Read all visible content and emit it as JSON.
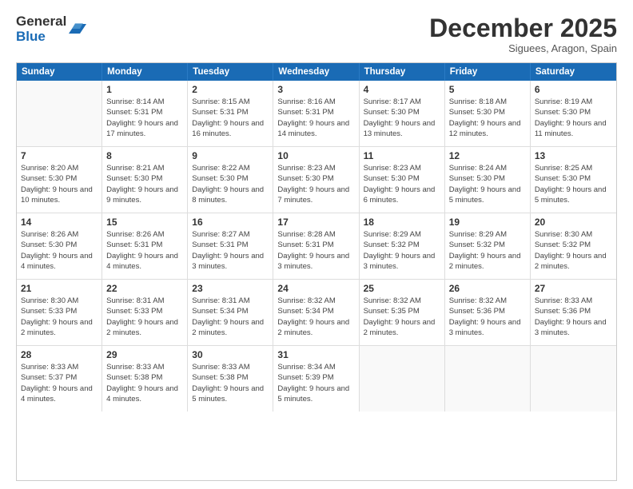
{
  "logo": {
    "general": "General",
    "blue": "Blue"
  },
  "title": "December 2025",
  "location": "Siguees, Aragon, Spain",
  "header_days": [
    "Sunday",
    "Monday",
    "Tuesday",
    "Wednesday",
    "Thursday",
    "Friday",
    "Saturday"
  ],
  "weeks": [
    [
      {
        "day": "",
        "empty": true
      },
      {
        "day": "1",
        "sunrise": "8:14 AM",
        "sunset": "5:31 PM",
        "daylight": "9 hours and 17 minutes."
      },
      {
        "day": "2",
        "sunrise": "8:15 AM",
        "sunset": "5:31 PM",
        "daylight": "9 hours and 16 minutes."
      },
      {
        "day": "3",
        "sunrise": "8:16 AM",
        "sunset": "5:31 PM",
        "daylight": "9 hours and 14 minutes."
      },
      {
        "day": "4",
        "sunrise": "8:17 AM",
        "sunset": "5:30 PM",
        "daylight": "9 hours and 13 minutes."
      },
      {
        "day": "5",
        "sunrise": "8:18 AM",
        "sunset": "5:30 PM",
        "daylight": "9 hours and 12 minutes."
      },
      {
        "day": "6",
        "sunrise": "8:19 AM",
        "sunset": "5:30 PM",
        "daylight": "9 hours and 11 minutes."
      }
    ],
    [
      {
        "day": "7",
        "sunrise": "8:20 AM",
        "sunset": "5:30 PM",
        "daylight": "9 hours and 10 minutes."
      },
      {
        "day": "8",
        "sunrise": "8:21 AM",
        "sunset": "5:30 PM",
        "daylight": "9 hours and 9 minutes."
      },
      {
        "day": "9",
        "sunrise": "8:22 AM",
        "sunset": "5:30 PM",
        "daylight": "9 hours and 8 minutes."
      },
      {
        "day": "10",
        "sunrise": "8:23 AM",
        "sunset": "5:30 PM",
        "daylight": "9 hours and 7 minutes."
      },
      {
        "day": "11",
        "sunrise": "8:23 AM",
        "sunset": "5:30 PM",
        "daylight": "9 hours and 6 minutes."
      },
      {
        "day": "12",
        "sunrise": "8:24 AM",
        "sunset": "5:30 PM",
        "daylight": "9 hours and 5 minutes."
      },
      {
        "day": "13",
        "sunrise": "8:25 AM",
        "sunset": "5:30 PM",
        "daylight": "9 hours and 5 minutes."
      }
    ],
    [
      {
        "day": "14",
        "sunrise": "8:26 AM",
        "sunset": "5:30 PM",
        "daylight": "9 hours and 4 minutes."
      },
      {
        "day": "15",
        "sunrise": "8:26 AM",
        "sunset": "5:31 PM",
        "daylight": "9 hours and 4 minutes."
      },
      {
        "day": "16",
        "sunrise": "8:27 AM",
        "sunset": "5:31 PM",
        "daylight": "9 hours and 3 minutes."
      },
      {
        "day": "17",
        "sunrise": "8:28 AM",
        "sunset": "5:31 PM",
        "daylight": "9 hours and 3 minutes."
      },
      {
        "day": "18",
        "sunrise": "8:29 AM",
        "sunset": "5:32 PM",
        "daylight": "9 hours and 3 minutes."
      },
      {
        "day": "19",
        "sunrise": "8:29 AM",
        "sunset": "5:32 PM",
        "daylight": "9 hours and 2 minutes."
      },
      {
        "day": "20",
        "sunrise": "8:30 AM",
        "sunset": "5:32 PM",
        "daylight": "9 hours and 2 minutes."
      }
    ],
    [
      {
        "day": "21",
        "sunrise": "8:30 AM",
        "sunset": "5:33 PM",
        "daylight": "9 hours and 2 minutes."
      },
      {
        "day": "22",
        "sunrise": "8:31 AM",
        "sunset": "5:33 PM",
        "daylight": "9 hours and 2 minutes."
      },
      {
        "day": "23",
        "sunrise": "8:31 AM",
        "sunset": "5:34 PM",
        "daylight": "9 hours and 2 minutes."
      },
      {
        "day": "24",
        "sunrise": "8:32 AM",
        "sunset": "5:34 PM",
        "daylight": "9 hours and 2 minutes."
      },
      {
        "day": "25",
        "sunrise": "8:32 AM",
        "sunset": "5:35 PM",
        "daylight": "9 hours and 2 minutes."
      },
      {
        "day": "26",
        "sunrise": "8:32 AM",
        "sunset": "5:36 PM",
        "daylight": "9 hours and 3 minutes."
      },
      {
        "day": "27",
        "sunrise": "8:33 AM",
        "sunset": "5:36 PM",
        "daylight": "9 hours and 3 minutes."
      }
    ],
    [
      {
        "day": "28",
        "sunrise": "8:33 AM",
        "sunset": "5:37 PM",
        "daylight": "9 hours and 4 minutes."
      },
      {
        "day": "29",
        "sunrise": "8:33 AM",
        "sunset": "5:38 PM",
        "daylight": "9 hours and 4 minutes."
      },
      {
        "day": "30",
        "sunrise": "8:33 AM",
        "sunset": "5:38 PM",
        "daylight": "9 hours and 5 minutes."
      },
      {
        "day": "31",
        "sunrise": "8:34 AM",
        "sunset": "5:39 PM",
        "daylight": "9 hours and 5 minutes."
      },
      {
        "day": "",
        "empty": true
      },
      {
        "day": "",
        "empty": true
      },
      {
        "day": "",
        "empty": true
      }
    ]
  ]
}
